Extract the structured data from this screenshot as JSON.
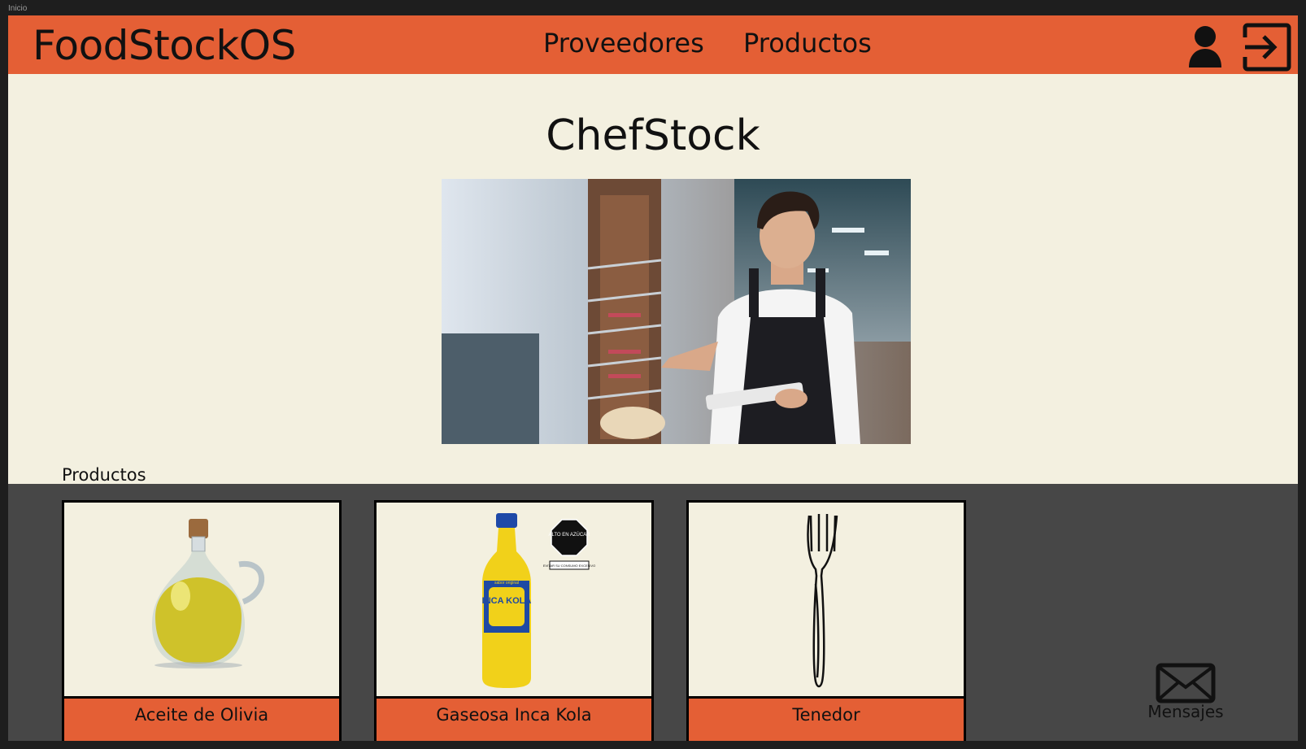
{
  "frame": {
    "label": "Inicio"
  },
  "header": {
    "brand": "FoodStockOS",
    "nav": [
      {
        "label": "Proveedores"
      },
      {
        "label": "Productos"
      }
    ],
    "icons": [
      "user-icon",
      "logout-icon"
    ]
  },
  "hero": {
    "title": "ChefStock",
    "image": "chef-checking-stock-photo"
  },
  "products": {
    "section_label": "Productos",
    "items": [
      {
        "label": "Aceite de Olivia",
        "image": "olive-oil-jug"
      },
      {
        "label": "Gaseosa Inca Kola",
        "image": "inca-kola-bottle",
        "badge": "ALTO EN AZÚCAR",
        "badge_note": "EVITAR SU CONSUMO EXCESIVO",
        "bottle_brand": "INCA KOLA",
        "bottle_tag": "sabor original"
      },
      {
        "label": "Tenedor",
        "image": "fork"
      }
    ]
  },
  "messages": {
    "label": "Mensajes",
    "icon": "envelope-icon"
  },
  "colors": {
    "accent": "#e45f35",
    "background": "#f3f0e0",
    "band": "#474747"
  }
}
